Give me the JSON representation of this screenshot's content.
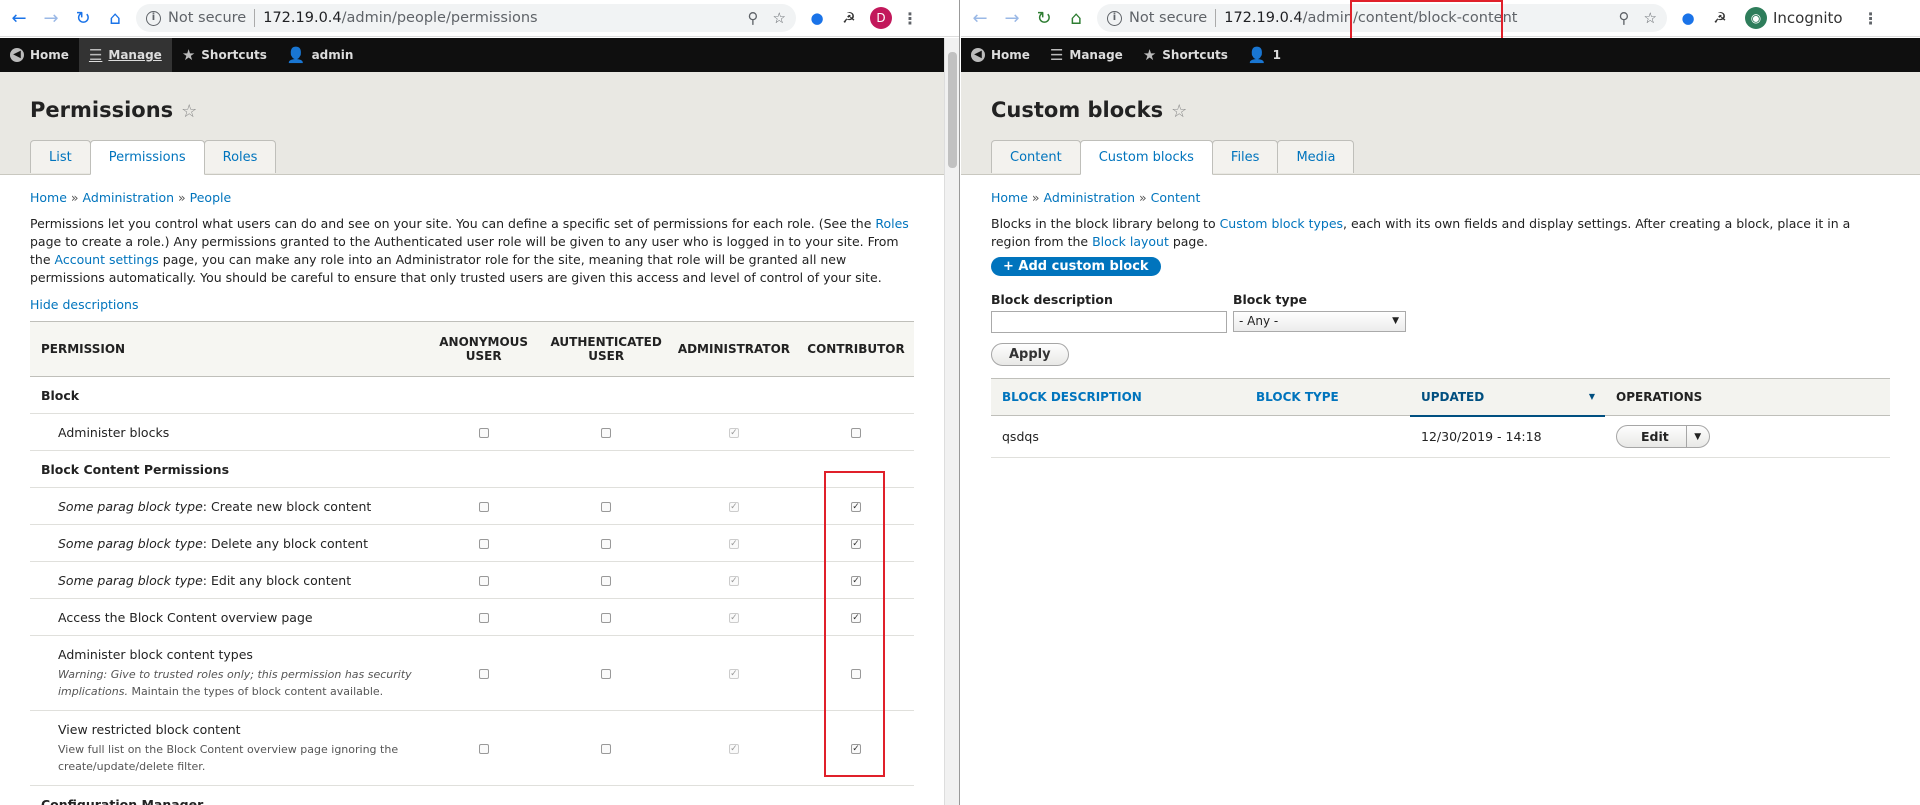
{
  "left": {
    "omni": {
      "secure": "Not secure",
      "url_host": "172.19.0.4",
      "url_path": "/admin/people/permissions"
    },
    "avatar_letter": "D",
    "toolbar": {
      "home": "Home",
      "manage": "Manage",
      "shortcuts": "Shortcuts",
      "user": "admin"
    },
    "page_title": "Permissions",
    "tabs": [
      "List",
      "Permissions",
      "Roles"
    ],
    "breadcrumb": {
      "home": "Home",
      "sep": "»",
      "admin": "Administration",
      "people": "People"
    },
    "desc": {
      "p1": "Permissions let you control what users can do and see on your site. You can define a specific set of permissions for each role. (See the ",
      "roles_link": "Roles",
      "p2": " page to create a role.) Any permissions granted to the Authenticated user role will be given to any user who is logged in to your site. From the ",
      "account_link": "Account settings",
      "p3": " page, you can make any role into an Administrator role for the site, meaning that role will be granted all new permissions automatically. You should be careful to ensure that only trusted users are given this access and level of control of your site."
    },
    "hide_descriptions": "Hide descriptions",
    "table": {
      "headers": [
        "PERMISSION",
        "ANONYMOUS USER",
        "AUTHENTICATED USER",
        "ADMINISTRATOR",
        "CONTRIBUTOR"
      ],
      "module1": "Block",
      "perm_admin_blocks": "Administer blocks",
      "module2": "Block Content Permissions",
      "type_label": "Some parag block type",
      "perm_create": ": Create new block content",
      "perm_delete": ": Delete any block content",
      "perm_edit": ": Edit any block content",
      "perm_access": "Access the Block Content overview page",
      "perm_admin_types": "Administer block content types",
      "warn": "Warning: Give to trusted roles only; this permission has security implications.",
      "warn_rest": " Maintain the types of block content available.",
      "perm_view_restricted": "View restricted block content",
      "view_restricted_desc": "View full list on the Block Content overview page ignoring the create/update/delete filter.",
      "module3": "Configuration Manager"
    },
    "contributor_checked": [
      false,
      true,
      true,
      true,
      true,
      false,
      true
    ]
  },
  "right": {
    "omni": {
      "secure": "Not secure",
      "url_host": "172.19.0.4",
      "url_path": "/admin/content/block-content"
    },
    "incognito": "Incognito",
    "toolbar": {
      "home": "Home",
      "manage": "Manage",
      "shortcuts": "Shortcuts",
      "user": "1"
    },
    "page_title": "Custom blocks",
    "tabs": [
      "Content",
      "Custom blocks",
      "Files",
      "Media"
    ],
    "breadcrumb": {
      "home": "Home",
      "sep": "»",
      "admin": "Administration",
      "content": "Content"
    },
    "desc": {
      "p1": "Blocks in the block library belong to ",
      "types_link": "Custom block types",
      "p2": ", each with its own fields and display settings. After creating a block, place it in a region from the ",
      "layout_link": "Block layout",
      "p3": " page."
    },
    "add_button": "+ Add custom block",
    "filter": {
      "desc_label": "Block description",
      "desc_value": "",
      "type_label": "Block type",
      "type_value": "- Any -",
      "apply": "Apply"
    },
    "table": {
      "headers": [
        "BLOCK DESCRIPTION",
        "BLOCK TYPE",
        "UPDATED",
        "OPERATIONS"
      ],
      "rows": [
        {
          "desc": "qsdqs",
          "type": "",
          "updated": "12/30/2019 - 14:18",
          "op": "Edit"
        }
      ]
    }
  },
  "colors": {
    "link": "#0074bd",
    "highlight": "#e0202a",
    "toolbar": "#0f0f0f"
  }
}
